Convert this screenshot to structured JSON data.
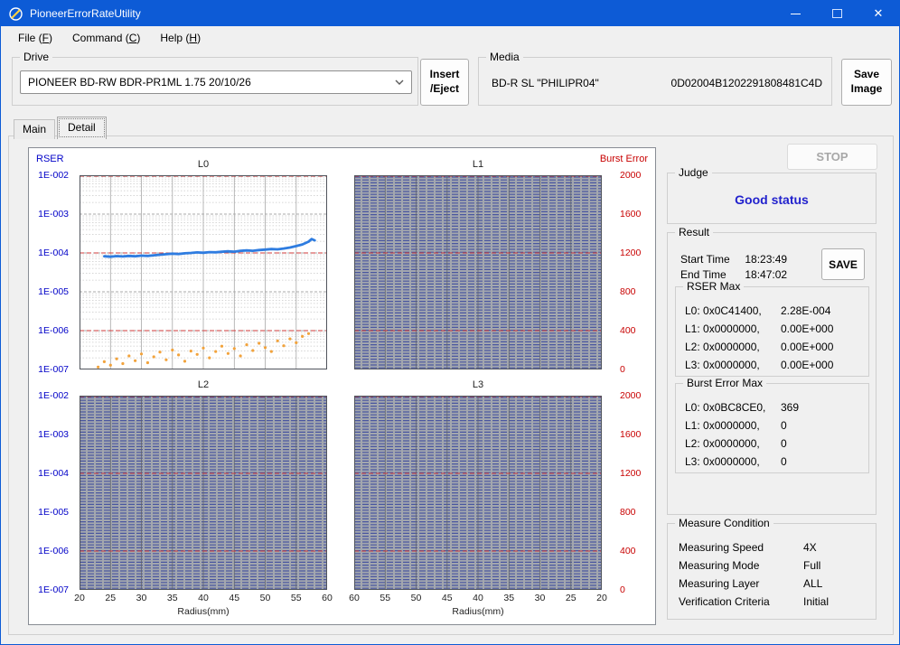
{
  "window": {
    "title": "PioneerErrorRateUtility"
  },
  "icons": {
    "close_glyph": "✕"
  },
  "menu": {
    "items": [
      {
        "pre": "File (",
        "key": "F",
        "post": ")"
      },
      {
        "pre": "Command (",
        "key": "C",
        "post": ")"
      },
      {
        "pre": "Help (",
        "key": "H",
        "post": ")"
      }
    ]
  },
  "drive": {
    "label": "Drive",
    "selected": "PIONEER BD-RW BDR-PR1ML 1.75 20/10/26"
  },
  "toolbar": {
    "insert_eject_line1": "Insert",
    "insert_eject_line2": "/Eject",
    "save_image_line1": "Save",
    "save_image_line2": "Image"
  },
  "media": {
    "label": "Media",
    "disc_type": "BD-R SL \"PHILIPR04\"",
    "disc_id": "0D02004B1202291808481C4D"
  },
  "tabs": [
    {
      "label": "Main"
    },
    {
      "label": "Detail"
    }
  ],
  "right_panel": {
    "stop_label": "STOP",
    "judge": {
      "label": "Judge",
      "status": "Good status"
    },
    "result": {
      "label": "Result",
      "start_time_label": "Start Time",
      "start_time": "18:23:49",
      "end_time_label": "End Time",
      "end_time": "18:47:02",
      "save_label": "SAVE",
      "rser_max": {
        "label": "RSER Max",
        "rows": [
          {
            "addr": "L0: 0x0C41400,",
            "value": "2.28E-004"
          },
          {
            "addr": "L1: 0x0000000,",
            "value": "0.00E+000"
          },
          {
            "addr": "L2: 0x0000000,",
            "value": "0.00E+000"
          },
          {
            "addr": "L3: 0x0000000,",
            "value": "0.00E+000"
          }
        ]
      },
      "burst_error_max": {
        "label": "Burst Error Max",
        "rows": [
          {
            "addr": "L0: 0x0BC8CE0,",
            "value": "369"
          },
          {
            "addr": "L1: 0x0000000,",
            "value": "0"
          },
          {
            "addr": "L2: 0x0000000,",
            "value": "0"
          },
          {
            "addr": "L3: 0x0000000,",
            "value": "0"
          }
        ]
      }
    },
    "measure_condition": {
      "label": "Measure Condition",
      "rows": [
        {
          "name": "Measuring Speed",
          "value": "4X"
        },
        {
          "name": "Measuring Mode",
          "value": "Full"
        },
        {
          "name": "Measuring Layer",
          "value": "ALL"
        },
        {
          "name": "Verification Criteria",
          "value": "Initial"
        }
      ]
    }
  },
  "chart_data": {
    "type": "line",
    "y_left": {
      "label": "RSER",
      "scale": "log",
      "max": "1E-002",
      "min": "1E-007",
      "ticks": [
        "1E-002",
        "1E-003",
        "1E-004",
        "1E-005",
        "1E-006",
        "1E-007"
      ]
    },
    "y_right": {
      "label": "Burst Error",
      "max": 2000,
      "min": 0,
      "ticks": [
        "2000",
        "1600",
        "1200",
        "800",
        "400",
        "0"
      ]
    },
    "x": {
      "label": "Radius(mm)",
      "min": 20,
      "max": 60,
      "ticks": [
        20,
        25,
        30,
        35,
        40,
        45,
        50,
        55,
        60
      ]
    },
    "red_lines_burst": [
      2000,
      1200,
      400
    ],
    "colors": {
      "rser_line": "#2e7ce0",
      "burst_dots": "#f2a33c",
      "filled_bg": "#a3a7ae",
      "filled_stripe": "#4a57a0",
      "red_line": "#cf3a3a",
      "left_axis": "#0202c8",
      "right_axis": "#c80202"
    },
    "charts": [
      {
        "title": "L0",
        "style": "data",
        "x_reversed": false,
        "rser_series": {
          "name": "RSER L0",
          "color": "#2e7ce0",
          "x": [
            24,
            25,
            26,
            27,
            28,
            29,
            30,
            31,
            32,
            33,
            34,
            35,
            36,
            37,
            38,
            39,
            40,
            41,
            42,
            43,
            44,
            45,
            46,
            47,
            48,
            49,
            50,
            51,
            52,
            53,
            54,
            55,
            56,
            57,
            57.5,
            58
          ],
          "y": [
            8.2e-05,
            8e-05,
            8.3e-05,
            8.1e-05,
            8.4e-05,
            8.2e-05,
            8.5e-05,
            8.4e-05,
            8.7e-05,
            9e-05,
            9.3e-05,
            9.6e-05,
            9.4e-05,
            9.8e-05,
            0.0001,
            0.000103,
            0.000101,
            0.000105,
            0.000104,
            0.000107,
            0.00011,
            0.000108,
            0.000113,
            0.000116,
            0.000114,
            0.000119,
            0.000122,
            0.000126,
            0.000124,
            0.00013,
            0.000138,
            0.00015,
            0.000165,
            0.000195,
            0.000228,
            0.00021
          ]
        },
        "burst_series": {
          "name": "Burst Error L0",
          "color": "#f2a33c",
          "x": [
            23,
            24,
            25,
            26,
            27,
            28,
            29,
            30,
            31,
            32,
            33,
            34,
            35,
            36,
            37,
            38,
            39,
            40,
            41,
            42,
            43,
            44,
            45,
            46,
            47,
            48,
            49,
            50,
            51,
            52,
            53,
            54,
            55,
            56,
            57
          ],
          "y": [
            25,
            80,
            45,
            110,
            60,
            140,
            90,
            160,
            70,
            130,
            180,
            100,
            200,
            150,
            85,
            190,
            155,
            220,
            120,
            185,
            240,
            165,
            215,
            140,
            255,
            195,
            270,
            225,
            185,
            295,
            245,
            315,
            275,
            340,
            369
          ]
        }
      },
      {
        "title": "L1",
        "style": "filled",
        "x_reversed": true
      },
      {
        "title": "L2",
        "style": "filled",
        "x_reversed": false
      },
      {
        "title": "L3",
        "style": "filled",
        "x_reversed": true
      }
    ]
  }
}
